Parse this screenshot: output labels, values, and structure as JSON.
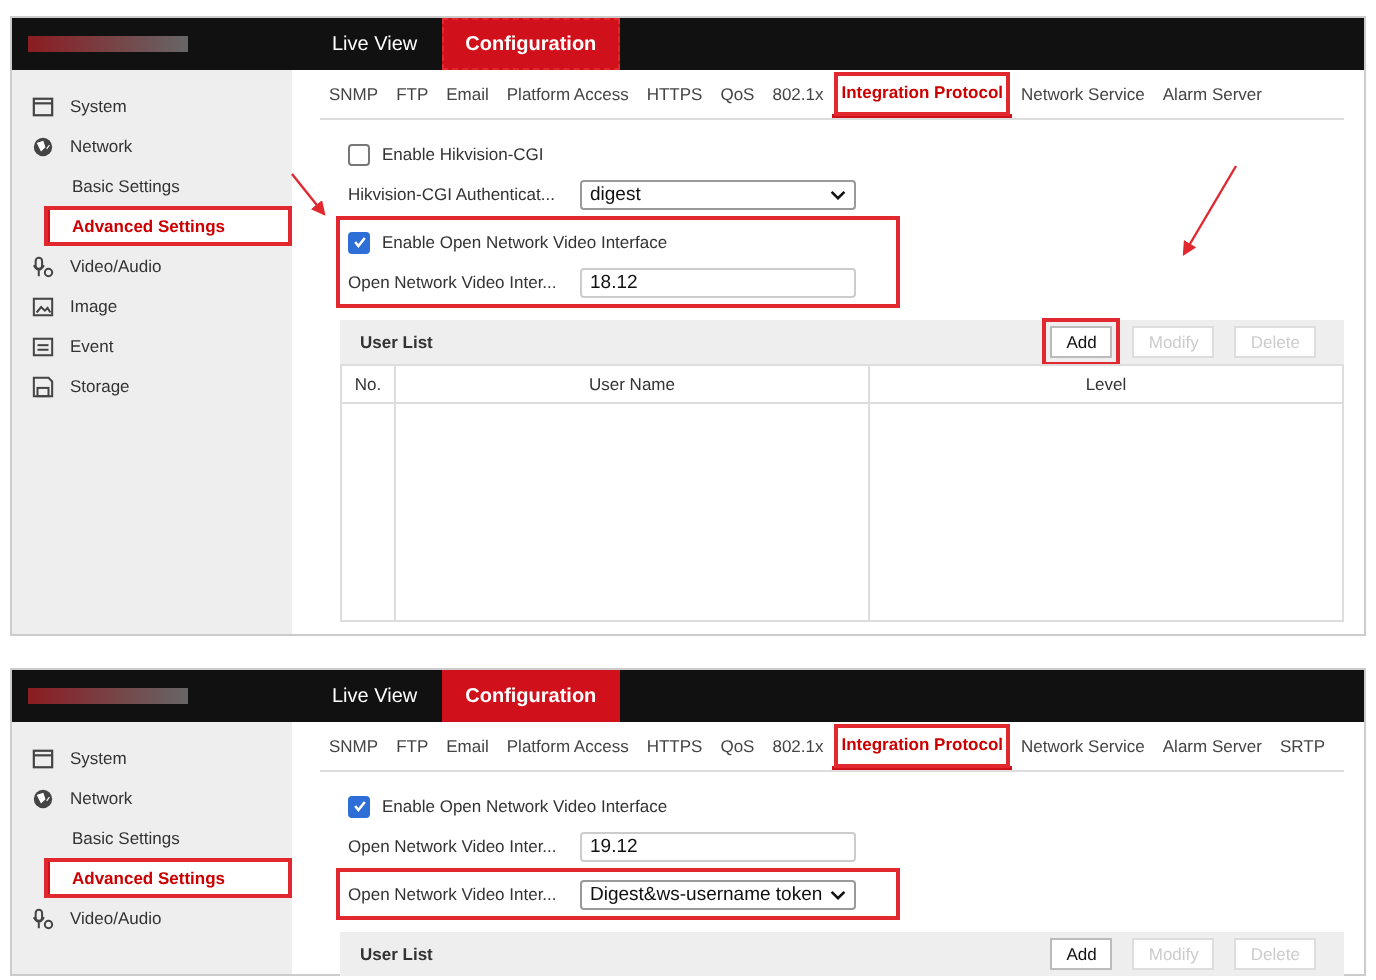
{
  "screenshots": [
    {
      "arrows": true,
      "nav": [
        {
          "label": "Live View",
          "selected": false,
          "highlighted": false
        },
        {
          "label": "Configuration",
          "selected": true,
          "highlighted": true
        }
      ],
      "sidebar": [
        {
          "label": "System",
          "selected": false,
          "highlighted": false
        },
        {
          "label": "Network",
          "selected": false,
          "highlighted": false,
          "children": [
            {
              "label": "Basic Settings",
              "selected": false,
              "highlighted": false
            },
            {
              "label": "Advanced Settings",
              "selected": true,
              "highlighted": true
            }
          ]
        },
        {
          "label": "Video/Audio",
          "selected": false,
          "highlighted": false
        },
        {
          "label": "Image",
          "selected": false,
          "highlighted": false
        },
        {
          "label": "Event",
          "selected": false,
          "highlighted": false
        },
        {
          "label": "Storage",
          "selected": false,
          "highlighted": false
        }
      ],
      "tabs": [
        {
          "label": "SNMP",
          "selected": false,
          "highlighted": false
        },
        {
          "label": "FTP",
          "selected": false,
          "highlighted": false
        },
        {
          "label": "Email",
          "selected": false,
          "highlighted": false
        },
        {
          "label": "Platform Access",
          "selected": false,
          "highlighted": false
        },
        {
          "label": "HTTPS",
          "selected": false,
          "highlighted": false
        },
        {
          "label": "QoS",
          "selected": false,
          "highlighted": false
        },
        {
          "label": "802.1x",
          "selected": false,
          "highlighted": false
        },
        {
          "label": "Integration Protocol",
          "selected": true,
          "highlighted": true
        },
        {
          "label": "Network Service",
          "selected": false,
          "highlighted": false
        },
        {
          "label": "Alarm Server",
          "selected": false,
          "highlighted": false
        }
      ],
      "field_groups": [
        {
          "highlighted": false,
          "fields": [
            {
              "kind": "checkbox",
              "label": "Enable Hikvision-CGI",
              "checked": false
            },
            {
              "kind": "select",
              "label": "Hikvision-CGI Authenticat...",
              "value": "digest"
            }
          ]
        },
        {
          "highlighted": true,
          "fields": [
            {
              "kind": "checkbox",
              "label": "Enable Open Network Video Interface",
              "checked": true
            },
            {
              "kind": "text",
              "label": "Open Network Video Inter...",
              "value": "18.12"
            }
          ]
        }
      ],
      "user_list": {
        "title": "User List",
        "buttons": [
          {
            "label": "Add",
            "disabled": false,
            "highlighted": true
          },
          {
            "label": "Modify",
            "disabled": true,
            "highlighted": false
          },
          {
            "label": "Delete",
            "disabled": true,
            "highlighted": false
          }
        ],
        "columns": [
          "No.",
          "User Name",
          "Level"
        ]
      }
    },
    {
      "arrows": false,
      "nav": [
        {
          "label": "Live View",
          "selected": false,
          "highlighted": false
        },
        {
          "label": "Configuration",
          "selected": true,
          "highlighted": false
        }
      ],
      "sidebar": [
        {
          "label": "System",
          "selected": false,
          "highlighted": false
        },
        {
          "label": "Network",
          "selected": false,
          "highlighted": false,
          "children": [
            {
              "label": "Basic Settings",
              "selected": false,
              "highlighted": false
            },
            {
              "label": "Advanced Settings",
              "selected": true,
              "highlighted": true
            }
          ]
        },
        {
          "label": "Video/Audio",
          "selected": false,
          "highlighted": false
        }
      ],
      "tabs": [
        {
          "label": "SNMP",
          "selected": false,
          "highlighted": false
        },
        {
          "label": "FTP",
          "selected": false,
          "highlighted": false
        },
        {
          "label": "Email",
          "selected": false,
          "highlighted": false
        },
        {
          "label": "Platform Access",
          "selected": false,
          "highlighted": false
        },
        {
          "label": "HTTPS",
          "selected": false,
          "highlighted": false
        },
        {
          "label": "QoS",
          "selected": false,
          "highlighted": false
        },
        {
          "label": "802.1x",
          "selected": false,
          "highlighted": false
        },
        {
          "label": "Integration Protocol",
          "selected": true,
          "highlighted": true
        },
        {
          "label": "Network Service",
          "selected": false,
          "highlighted": false
        },
        {
          "label": "Alarm Server",
          "selected": false,
          "highlighted": false
        },
        {
          "label": "SRTP",
          "selected": false,
          "highlighted": false
        }
      ],
      "field_groups": [
        {
          "highlighted": false,
          "fields": [
            {
              "kind": "checkbox",
              "label": "Enable Open Network Video Interface",
              "checked": true
            },
            {
              "kind": "text",
              "label": "Open Network Video Inter...",
              "value": "19.12"
            }
          ]
        },
        {
          "highlighted": true,
          "fields": [
            {
              "kind": "select",
              "label": "Open Network Video Inter...",
              "value": "Digest&ws-username token"
            }
          ]
        }
      ],
      "user_list": {
        "title": "User List",
        "buttons": [
          {
            "label": "Add",
            "disabled": false,
            "highlighted": false
          },
          {
            "label": "Modify",
            "disabled": true,
            "highlighted": false
          },
          {
            "label": "Delete",
            "disabled": true,
            "highlighted": false
          }
        ]
      }
    }
  ]
}
